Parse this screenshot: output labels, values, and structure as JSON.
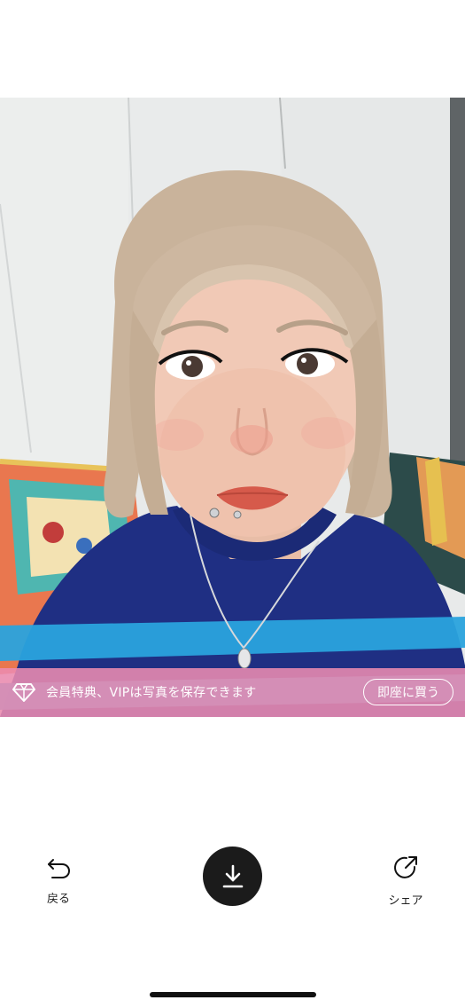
{
  "photo": {
    "subject": "selfie photo"
  },
  "vip_banner": {
    "text": "会員特典、VIPは写真を保存できます",
    "buy_label": "即座に買う",
    "background": "#EC8CB0"
  },
  "toolbar": {
    "back_label": "戻る",
    "share_label": "シェア",
    "download_icon": "download-icon",
    "back_icon": "undo-arrow-icon",
    "share_icon": "share-arrow-icon"
  }
}
